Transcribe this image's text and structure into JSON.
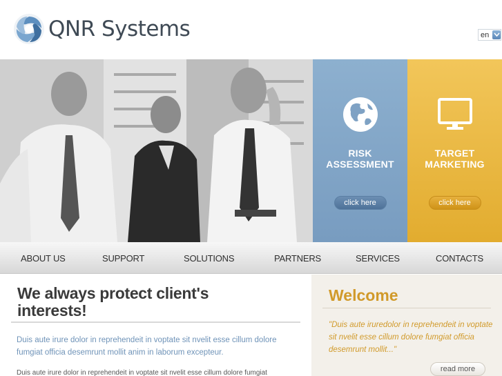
{
  "header": {
    "logo_text": "QNR Systems",
    "language": "en"
  },
  "hero": {
    "panels": [
      {
        "title_line1": "RISK",
        "title_line2": "ASSESSMENT",
        "icon": "globe-icon",
        "button": "click here",
        "color": "#7fa2c4"
      },
      {
        "title_line1": "TARGET",
        "title_line2": "MARKETING",
        "icon": "monitor-icon",
        "button": "click here",
        "color": "#e8b43f"
      }
    ]
  },
  "nav": {
    "items": [
      "ABOUT US",
      "SUPPORT",
      "SOLUTIONS",
      "PARTNERS",
      "SERVICES",
      "CONTACTS"
    ]
  },
  "main": {
    "title_line1": "We always protect client's",
    "title_line2": "interests!",
    "lead": "Duis aute irure dolor in reprehendeit in voptate sit nvelit esse cillum dolore fumgiat officia desemrunt mollit anim in laborum excepteur.",
    "body": "Duis aute irure dolor in reprehendeit in voptate sit nvelit esse cillum dolore fumgiat"
  },
  "sidebar": {
    "title": "Welcome",
    "quote": "\"Duis aute iruredolor in reprehendeit in voptate sit nvelit esse cillum dolore fumgiat officia desemrunt mollit...\"",
    "button": "read more"
  },
  "colors": {
    "accent_blue": "#7fa2c4",
    "accent_gold": "#e8b43f",
    "lead_text": "#6f93b8",
    "welcome_text": "#d19a2a"
  }
}
